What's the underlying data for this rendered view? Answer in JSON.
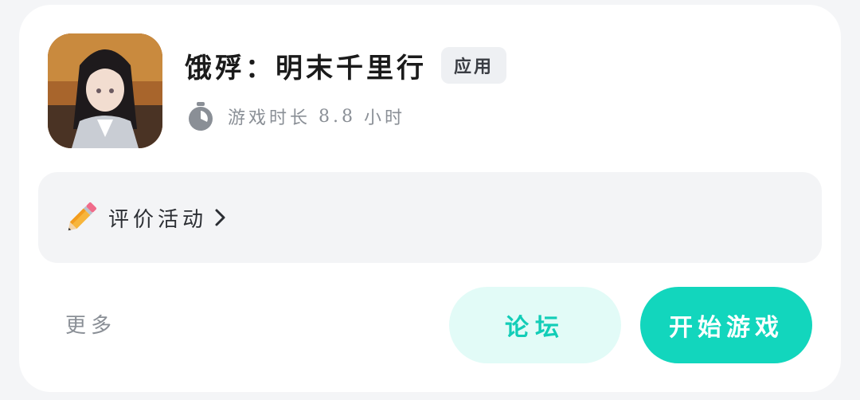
{
  "game": {
    "title": "饿殍：明末千里行",
    "type_tag": "应用",
    "icon": "game-cover-art",
    "playtime_label": "游戏时长",
    "playtime_value": "8.8",
    "playtime_unit": "小时"
  },
  "review": {
    "icon": "pencil-icon",
    "label": "评价活动"
  },
  "actions": {
    "more_label": "更多",
    "forum_label": "论坛",
    "start_label": "开始游戏"
  },
  "colors": {
    "accent": "#12d6bd",
    "accent_light": "#e2fbf7",
    "accent_text": "#12cdb7",
    "muted_text": "#8a8f96",
    "panel_bg": "#f3f4f6"
  }
}
